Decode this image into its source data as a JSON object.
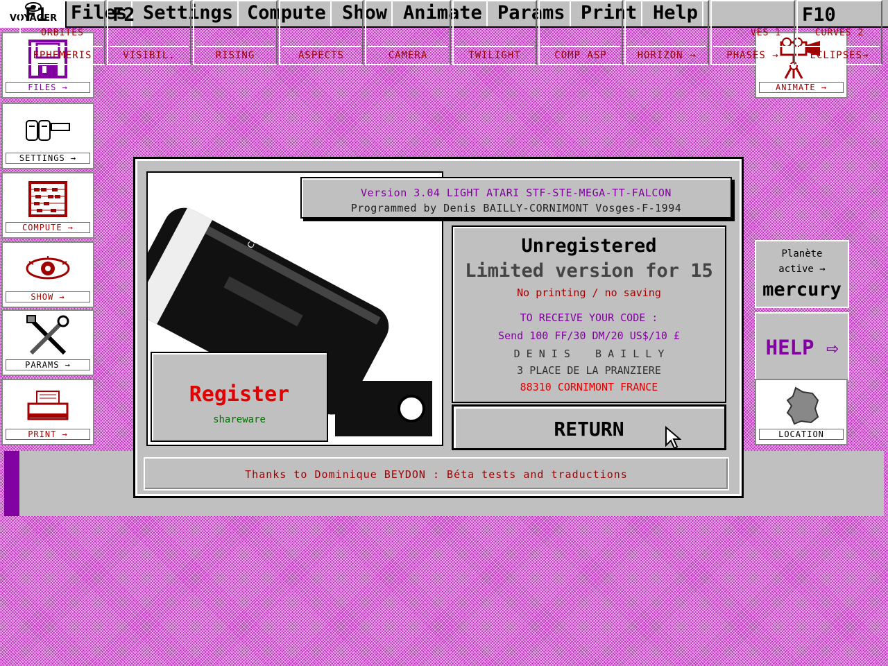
{
  "app": {
    "logo_text": "VOYAGER"
  },
  "menu": [
    "Files",
    "Settings",
    "Compute",
    "Show",
    "Animate",
    "Params",
    "Print",
    "Help"
  ],
  "left_tiles": [
    {
      "label": "FILES →",
      "icon": "floppy-disk-icon"
    },
    {
      "label": "SETTINGS →",
      "icon": "binoculars-icon"
    },
    {
      "label": "COMPUTE →",
      "icon": "abacus-icon"
    },
    {
      "label": "SHOW →",
      "icon": "eye-icon"
    },
    {
      "label": "PARAMS →",
      "icon": "tools-icon"
    },
    {
      "label": "PRINT →",
      "icon": "printer-icon"
    }
  ],
  "right_tiles": {
    "animate_label": "ANIMATE →",
    "planet_line1": "Planète",
    "planet_line2": "active →",
    "planet_name": "mercury",
    "help_label": "HELP ⇨",
    "location_label": "LOCATION"
  },
  "fkeys": [
    {
      "key": "F1",
      "top": "ORBITES",
      "bottom": "EPHEMERIS"
    },
    {
      "key": "F2",
      "top": "",
      "bottom": "VISIBIL."
    },
    {
      "key": "",
      "top": "",
      "bottom": "RISING"
    },
    {
      "key": "",
      "top": "",
      "bottom": "ASPECTS"
    },
    {
      "key": "",
      "top": "",
      "bottom": "CAMERA"
    },
    {
      "key": "",
      "top": "",
      "bottom": "TWILIGHT"
    },
    {
      "key": "",
      "top": "",
      "bottom": "COMP ASP"
    },
    {
      "key": "",
      "top": "",
      "bottom": "HORIZON →"
    },
    {
      "key": "",
      "top": "VES 1",
      "bottom": "PHASES →"
    },
    {
      "key": "F10",
      "top": "CURVES 2",
      "bottom": "ECLIPSES→"
    }
  ],
  "dialog": {
    "version_line1": "Version 3.04 LIGHT ATARI STF-STE-MEGA-TT-FALCON",
    "version_line2": "Programmed by Denis BAILLY-CORNIMONT Vosges-F-1994",
    "status_title": "Unregistered",
    "status_subtitle": "Limited version for 15",
    "restrictions": "No printing  / no saving",
    "receive_code": "TO RECEIVE YOUR CODE :",
    "price": "Send 100 FF/30 DM/20 US$/10 £",
    "author_name": "D E N I S    B A I L L Y",
    "address1": "3 PLACE DE LA PRANZIERE",
    "address2": "88310 CORNIMONT FRANCE",
    "register_label": "Register",
    "register_sub": "shareware",
    "return_label": "RETURN",
    "thanks": "Thanks to Dominique BEYDON : Béta tests and traductions",
    "photo_brand": "CELESTRON"
  },
  "colors": {
    "background": "#c030c0",
    "panel": "#c0c0c0",
    "red": "#e00000",
    "purple": "#8000a0",
    "green": "#007000"
  }
}
